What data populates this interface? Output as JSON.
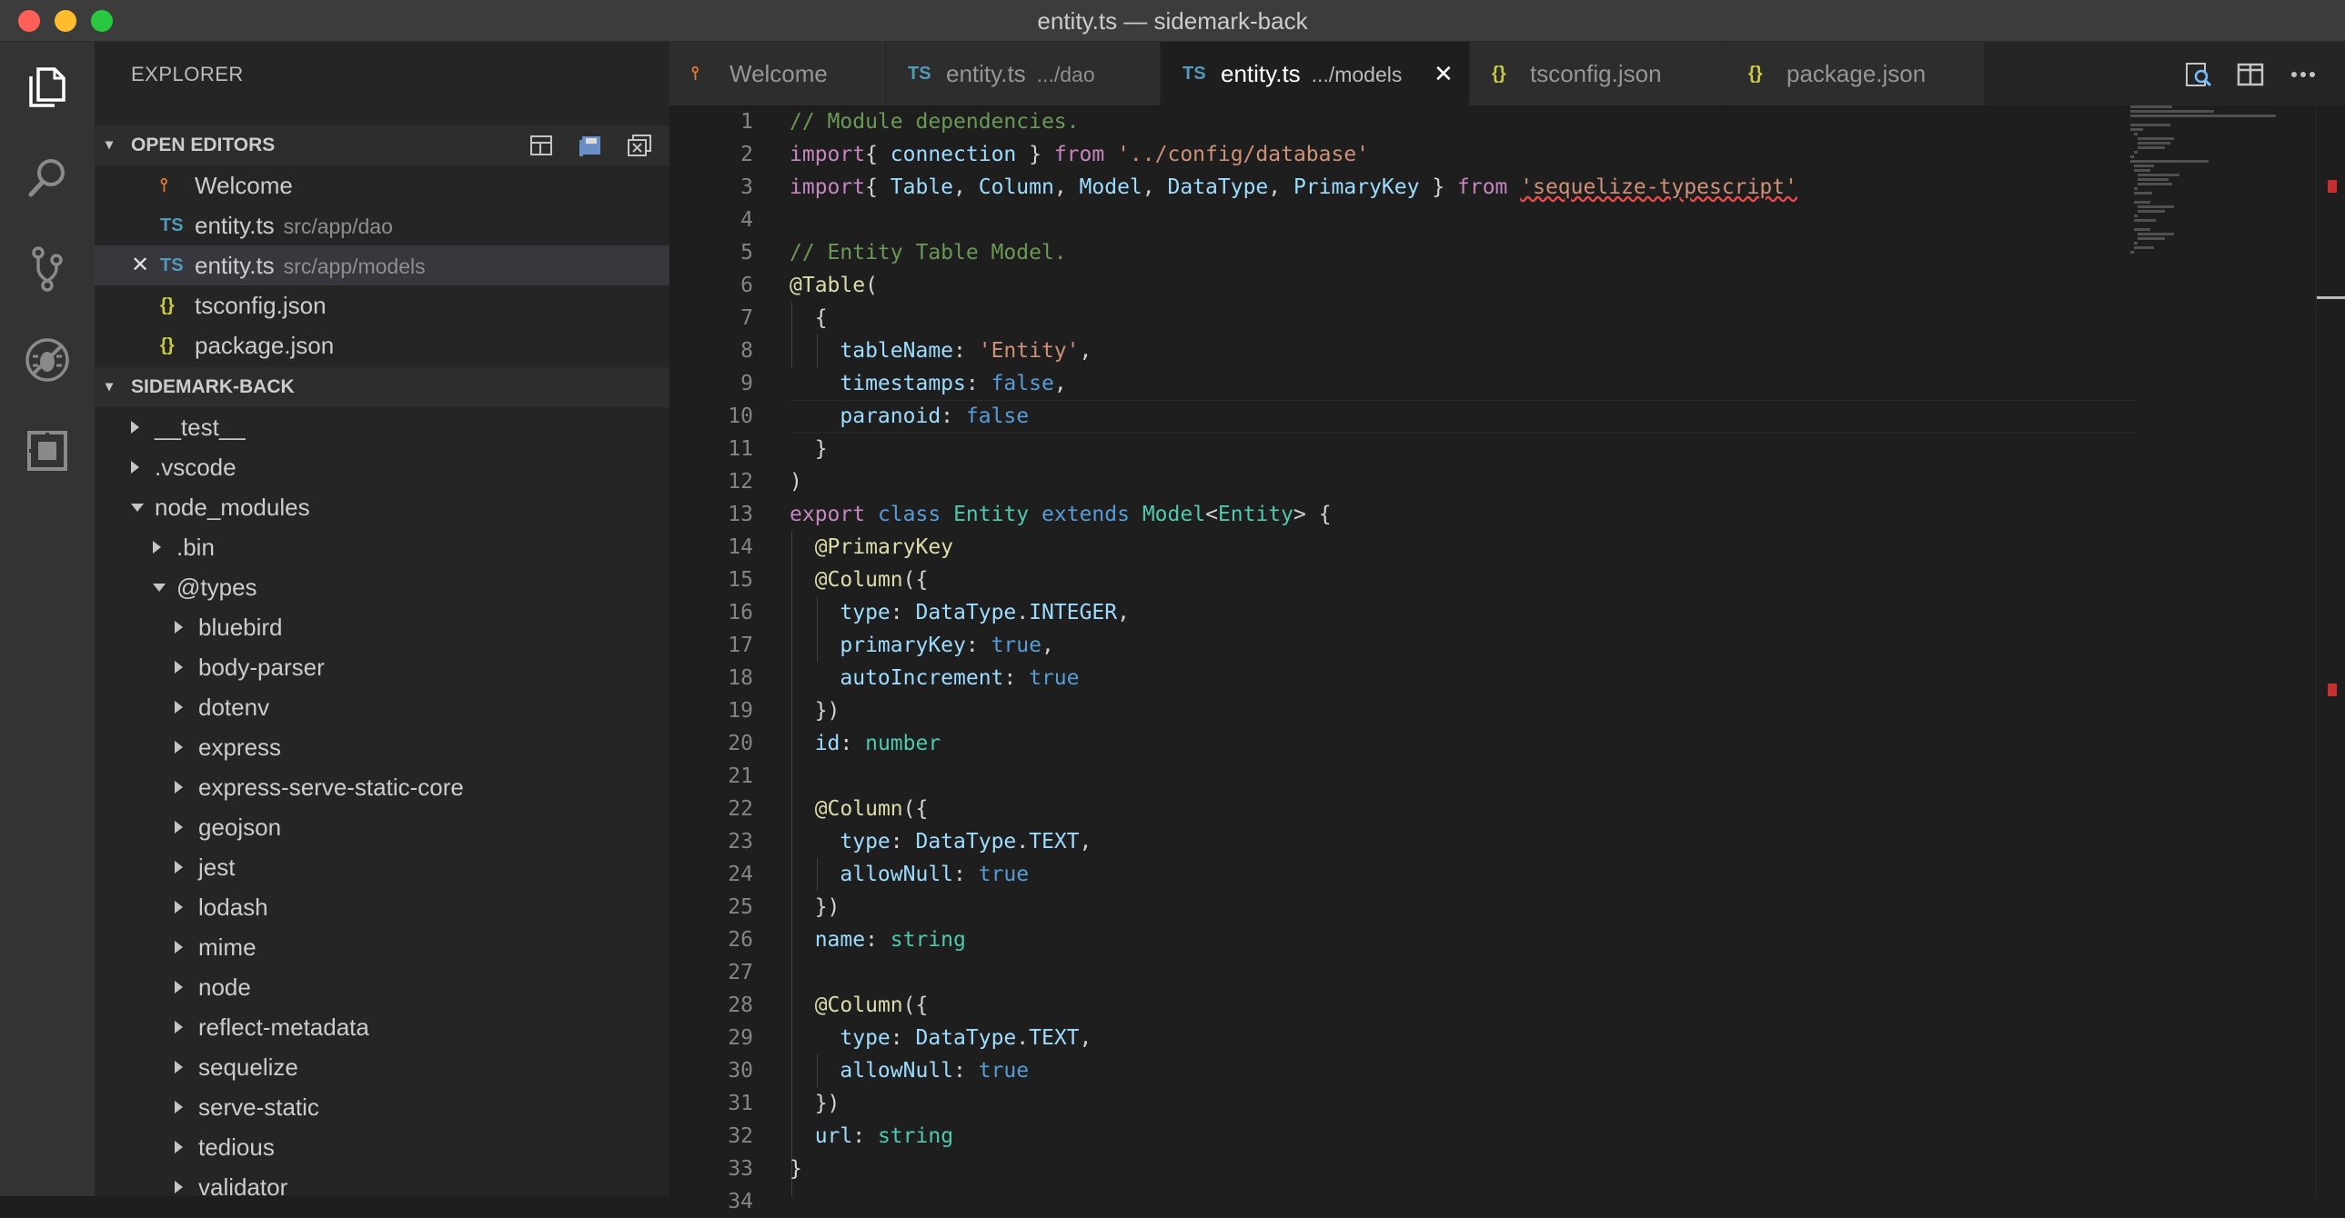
{
  "window": {
    "title": "entity.ts — sidemark-back",
    "traffic_colors": [
      "#ff5f57",
      "#febc2e",
      "#28c840"
    ]
  },
  "activity": [
    "files-icon",
    "search-icon",
    "source-control-icon",
    "debug-icon",
    "extensions-icon"
  ],
  "sidebar": {
    "title": "EXPLORER",
    "open_editors": {
      "header": "OPEN EDITORS",
      "items": [
        {
          "icon": "vscode-logo-icon",
          "glyph": "⫯",
          "icon_color": "#e37933",
          "name": "Welcome",
          "desc": "",
          "selected": false,
          "close": ""
        },
        {
          "icon": "ts-file-icon",
          "glyph": "TS",
          "icon_color": "#519aba",
          "name": "entity.ts",
          "desc": "src/app/dao",
          "selected": false,
          "close": ""
        },
        {
          "icon": "ts-file-icon",
          "glyph": "TS",
          "icon_color": "#519aba",
          "name": "entity.ts",
          "desc": "src/app/models",
          "selected": true,
          "close": "✕"
        },
        {
          "icon": "json-file-icon",
          "glyph": "{}",
          "icon_color": "#cbcb41",
          "name": "tsconfig.json",
          "desc": "",
          "selected": false,
          "close": ""
        },
        {
          "icon": "json-file-icon",
          "glyph": "{}",
          "icon_color": "#cbcb41",
          "name": "package.json",
          "desc": "",
          "selected": false,
          "close": ""
        }
      ]
    },
    "project": {
      "header": "SIDEMARK-BACK",
      "tree": [
        {
          "name": "__test__",
          "depth": 0,
          "open": false
        },
        {
          "name": ".vscode",
          "depth": 0,
          "open": false
        },
        {
          "name": "node_modules",
          "depth": 0,
          "open": true
        },
        {
          "name": ".bin",
          "depth": 1,
          "open": false
        },
        {
          "name": "@types",
          "depth": 1,
          "open": true
        },
        {
          "name": "bluebird",
          "depth": 2,
          "open": false
        },
        {
          "name": "body-parser",
          "depth": 2,
          "open": false
        },
        {
          "name": "dotenv",
          "depth": 2,
          "open": false
        },
        {
          "name": "express",
          "depth": 2,
          "open": false
        },
        {
          "name": "express-serve-static-core",
          "depth": 2,
          "open": false
        },
        {
          "name": "geojson",
          "depth": 2,
          "open": false
        },
        {
          "name": "jest",
          "depth": 2,
          "open": false
        },
        {
          "name": "lodash",
          "depth": 2,
          "open": false
        },
        {
          "name": "mime",
          "depth": 2,
          "open": false
        },
        {
          "name": "node",
          "depth": 2,
          "open": false
        },
        {
          "name": "reflect-metadata",
          "depth": 2,
          "open": false
        },
        {
          "name": "sequelize",
          "depth": 2,
          "open": false
        },
        {
          "name": "serve-static",
          "depth": 2,
          "open": false
        },
        {
          "name": "tedious",
          "depth": 2,
          "open": false
        },
        {
          "name": "validator",
          "depth": 2,
          "open": false
        }
      ]
    }
  },
  "tabs": [
    {
      "icon": "vscode-logo-icon",
      "glyph": "⫯",
      "icon_color": "#e37933",
      "label": "Welcome",
      "desc": "",
      "active": false,
      "close": ""
    },
    {
      "icon": "ts-file-icon",
      "glyph": "TS",
      "icon_color": "#519aba",
      "label": "entity.ts",
      "desc": ".../dao",
      "active": false,
      "close": ""
    },
    {
      "icon": "ts-file-icon",
      "glyph": "TS",
      "icon_color": "#519aba",
      "label": "entity.ts",
      "desc": ".../models",
      "active": true,
      "close": "✕"
    },
    {
      "icon": "json-file-icon",
      "glyph": "{}",
      "icon_color": "#cbcb41",
      "label": "tsconfig.json",
      "desc": "",
      "active": false,
      "close": ""
    },
    {
      "icon": "json-file-icon",
      "glyph": "{}",
      "icon_color": "#cbcb41",
      "label": "package.json",
      "desc": "",
      "active": false,
      "close": ""
    }
  ],
  "editor_actions": [
    "open-changes-icon",
    "split-editor-icon",
    "more-actions-icon"
  ],
  "code": [
    [
      [
        "c-com",
        "// Module dependencies."
      ]
    ],
    [
      [
        "c-kw",
        "import"
      ],
      [
        "",
        "{ "
      ],
      [
        "c-id",
        "connection"
      ],
      [
        "",
        " } "
      ],
      [
        "c-kw",
        "from"
      ],
      [
        "",
        " "
      ],
      [
        "c-str",
        "'../config/database'"
      ]
    ],
    [
      [
        "c-kw",
        "import"
      ],
      [
        "",
        "{ "
      ],
      [
        "c-id",
        "Table"
      ],
      [
        "",
        ", "
      ],
      [
        "c-id",
        "Column"
      ],
      [
        "",
        ", "
      ],
      [
        "c-id",
        "Model"
      ],
      [
        "",
        ", "
      ],
      [
        "c-id",
        "DataType"
      ],
      [
        "",
        ", "
      ],
      [
        "c-id",
        "PrimaryKey"
      ],
      [
        "",
        " } "
      ],
      [
        "c-kw",
        "from"
      ],
      [
        "",
        " "
      ],
      [
        "c-str c-squig",
        "'sequelize-typescript'"
      ]
    ],
    [],
    [
      [
        "c-com",
        "// Entity Table Model."
      ]
    ],
    [
      [
        "c-fn",
        "@Table"
      ],
      [
        "",
        "("
      ]
    ],
    [
      [
        "",
        "  {"
      ]
    ],
    [
      [
        "",
        "    "
      ],
      [
        "c-id",
        "tableName"
      ],
      [
        "",
        ": "
      ],
      [
        "c-str",
        "'Entity'"
      ],
      [
        "",
        ","
      ]
    ],
    [
      [
        "",
        "    "
      ],
      [
        "c-id",
        "timestamps"
      ],
      [
        "",
        ": "
      ],
      [
        "c-kw2",
        "false"
      ],
      [
        "",
        ","
      ]
    ],
    [
      [
        "",
        "    "
      ],
      [
        "c-id",
        "paranoid"
      ],
      [
        "",
        ": "
      ],
      [
        "c-kw2",
        "false"
      ]
    ],
    [
      [
        "",
        "  }"
      ]
    ],
    [
      [
        "",
        ")"
      ]
    ],
    [
      [
        "c-kw",
        "export"
      ],
      [
        "",
        " "
      ],
      [
        "c-kw2",
        "class"
      ],
      [
        "",
        " "
      ],
      [
        "c-type",
        "Entity"
      ],
      [
        "",
        " "
      ],
      [
        "c-kw2",
        "extends"
      ],
      [
        "",
        " "
      ],
      [
        "c-type",
        "Model"
      ],
      [
        "",
        "<"
      ],
      [
        "c-type",
        "Entity"
      ],
      [
        "",
        "> {"
      ]
    ],
    [
      [
        "",
        "  "
      ],
      [
        "c-fn",
        "@PrimaryKey"
      ]
    ],
    [
      [
        "",
        "  "
      ],
      [
        "c-fn",
        "@Column"
      ],
      [
        "",
        "({"
      ]
    ],
    [
      [
        "",
        "    "
      ],
      [
        "c-id",
        "type"
      ],
      [
        "",
        ": "
      ],
      [
        "c-id",
        "DataType"
      ],
      [
        "",
        "."
      ],
      [
        "c-id",
        "INTEGER"
      ],
      [
        "",
        ","
      ]
    ],
    [
      [
        "",
        "    "
      ],
      [
        "c-id",
        "primaryKey"
      ],
      [
        "",
        ": "
      ],
      [
        "c-kw2",
        "true"
      ],
      [
        "",
        ","
      ]
    ],
    [
      [
        "",
        "    "
      ],
      [
        "c-id",
        "autoIncrement"
      ],
      [
        "",
        ": "
      ],
      [
        "c-kw2",
        "true"
      ]
    ],
    [
      [
        "",
        "  })"
      ]
    ],
    [
      [
        "",
        "  "
      ],
      [
        "c-id",
        "id"
      ],
      [
        "",
        ": "
      ],
      [
        "c-type",
        "number"
      ]
    ],
    [],
    [
      [
        "",
        "  "
      ],
      [
        "c-fn",
        "@Column"
      ],
      [
        "",
        "({"
      ]
    ],
    [
      [
        "",
        "    "
      ],
      [
        "c-id",
        "type"
      ],
      [
        "",
        ": "
      ],
      [
        "c-id",
        "DataType"
      ],
      [
        "",
        "."
      ],
      [
        "c-id",
        "TEXT"
      ],
      [
        "",
        ","
      ]
    ],
    [
      [
        "",
        "    "
      ],
      [
        "c-id",
        "allowNull"
      ],
      [
        "",
        ": "
      ],
      [
        "c-kw2",
        "true"
      ]
    ],
    [
      [
        "",
        "  })"
      ]
    ],
    [
      [
        "",
        "  "
      ],
      [
        "c-id",
        "name"
      ],
      [
        "",
        ": "
      ],
      [
        "c-type",
        "string"
      ]
    ],
    [],
    [
      [
        "",
        "  "
      ],
      [
        "c-fn",
        "@Column"
      ],
      [
        "",
        "({"
      ]
    ],
    [
      [
        "",
        "    "
      ],
      [
        "c-id",
        "type"
      ],
      [
        "",
        ": "
      ],
      [
        "c-id",
        "DataType"
      ],
      [
        "",
        "."
      ],
      [
        "c-id",
        "TEXT"
      ],
      [
        "",
        ","
      ]
    ],
    [
      [
        "",
        "    "
      ],
      [
        "c-id",
        "allowNull"
      ],
      [
        "",
        ": "
      ],
      [
        "c-kw2",
        "true"
      ]
    ],
    [
      [
        "",
        "  })"
      ]
    ],
    [
      [
        "",
        "  "
      ],
      [
        "c-id",
        "url"
      ],
      [
        "",
        ": "
      ],
      [
        "c-type",
        "string"
      ]
    ],
    [
      [
        "",
        "}"
      ]
    ],
    []
  ],
  "line_numbers": [
    "1",
    "2",
    "3",
    "4",
    "5",
    "6",
    "7",
    "8",
    "9",
    "10",
    "11",
    "12",
    "13",
    "14",
    "15",
    "16",
    "17",
    "18",
    "19",
    "20",
    "21",
    "22",
    "23",
    "24",
    "25",
    "26",
    "27",
    "28",
    "29",
    "30",
    "31",
    "32",
    "33",
    "34"
  ],
  "current_line": 10
}
